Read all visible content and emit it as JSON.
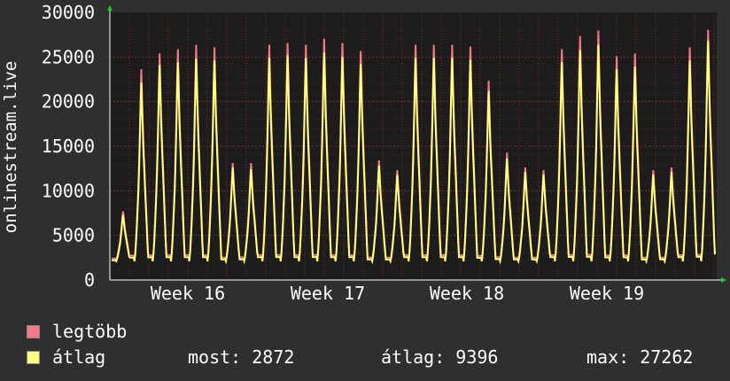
{
  "chart_data": {
    "type": "area",
    "ylabel": "onlinestream.live",
    "ylim": [
      0,
      30000
    ],
    "y_ticks": [
      "30000",
      "25000",
      "20000",
      "15000",
      "10000",
      "5000",
      "0"
    ],
    "x_ticks": [
      "Week 16",
      "Week 17",
      "Week 18",
      "Week 19"
    ],
    "grid": true,
    "colors": {
      "background": "#2f2f2f",
      "plot_bg": "#1c1c1c",
      "grid": "#7a2a2a",
      "max": "#f27a87",
      "avg": "#ffff80",
      "axis": "#ffffff"
    },
    "series": [
      {
        "name": "legtöbb",
        "values": [
          7800,
          24000,
          25800,
          26300,
          26800,
          26500,
          13300,
          13300,
          26800,
          27000,
          26800,
          27500,
          27000,
          26100,
          13600,
          12500,
          26800,
          26800,
          26800,
          26600,
          22700,
          14500,
          12800,
          12500,
          26300,
          27800,
          28400,
          25500,
          25800,
          12500,
          12800,
          26500,
          28500
        ]
      },
      {
        "name": "átlag",
        "values": [
          7400,
          22500,
          24500,
          24800,
          25200,
          25000,
          12800,
          12600,
          25300,
          25600,
          25300,
          25900,
          25400,
          24600,
          13000,
          12000,
          25300,
          25300,
          25300,
          25100,
          21500,
          13800,
          12300,
          12000,
          24800,
          26200,
          26800,
          24000,
          24300,
          12000,
          12300,
          25000,
          27262
        ]
      }
    ]
  },
  "legend": {
    "max_label": "legtöbb",
    "avg_label": "átlag"
  },
  "stats": {
    "now": "most: 2872",
    "avg": "átlag: 9396",
    "max": "max: 27262"
  }
}
